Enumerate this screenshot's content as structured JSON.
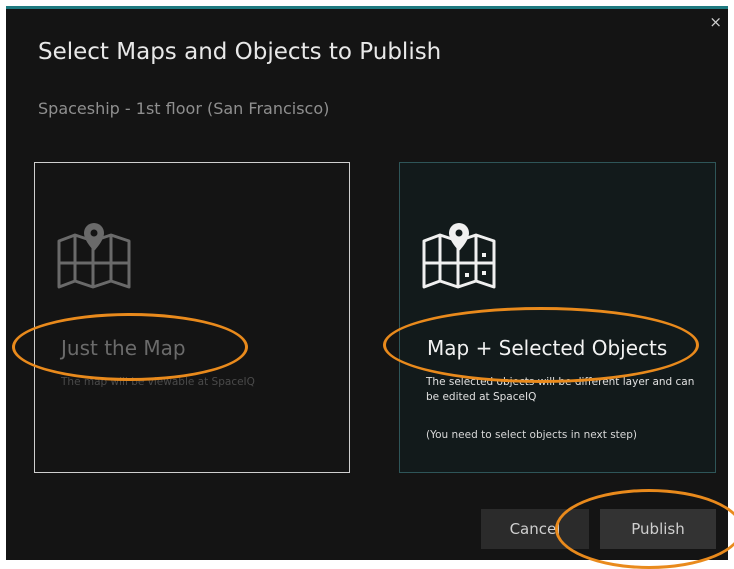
{
  "dialog": {
    "close_glyph": "×",
    "title": "Select Maps and Objects to Publish",
    "subtitle": "Spaceship - 1st floor (San Francisco)"
  },
  "options": {
    "just_map": {
      "title": "Just the Map",
      "description": "The map will be viewable at SpaceIQ",
      "icon": "map-pin-icon"
    },
    "map_objects": {
      "title": "Map + Selected Objects",
      "description": "The selected objects will be different layer and can be edited at SpaceIQ",
      "note": "(You need to select objects in next step)",
      "icon": "map-pin-objects-icon"
    }
  },
  "buttons": {
    "cancel": "Cancel",
    "publish": "Publish"
  },
  "colors": {
    "accent": "#1e7a80",
    "highlight": "#e98a1c",
    "background": "#141414"
  }
}
